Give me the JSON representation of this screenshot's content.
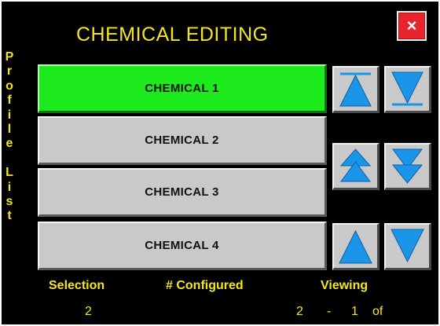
{
  "title": "CHEMICAL EDITING",
  "close_label": "×",
  "side_label": [
    "P",
    "r",
    "o",
    "f",
    "i",
    "l",
    "e",
    "",
    "L",
    "i",
    "s",
    "t"
  ],
  "chemicals": [
    {
      "label": "CHEMICAL 1",
      "selected": true
    },
    {
      "label": "CHEMICAL 2",
      "selected": false
    },
    {
      "label": "CHEMICAL 3",
      "selected": false
    },
    {
      "label": "CHEMICAL 4",
      "selected": false
    }
  ],
  "arrows": {
    "top": "jump-first-last",
    "page": "page-up-down",
    "step": "step-up-down"
  },
  "footer": {
    "selection_label": "Selection",
    "configured_label": "# Configured",
    "viewing_label": "Viewing",
    "selection_value": "2",
    "configured_value": "2",
    "viewing_dash": "-",
    "viewing_start": "1",
    "viewing_of": "of"
  },
  "colors": {
    "background": "#000000",
    "text_accent": "#f5e61c",
    "selected": "#1cea1c",
    "button": "#c9c9c9",
    "arrow": "#1a95e8",
    "close": "#e8242c"
  }
}
